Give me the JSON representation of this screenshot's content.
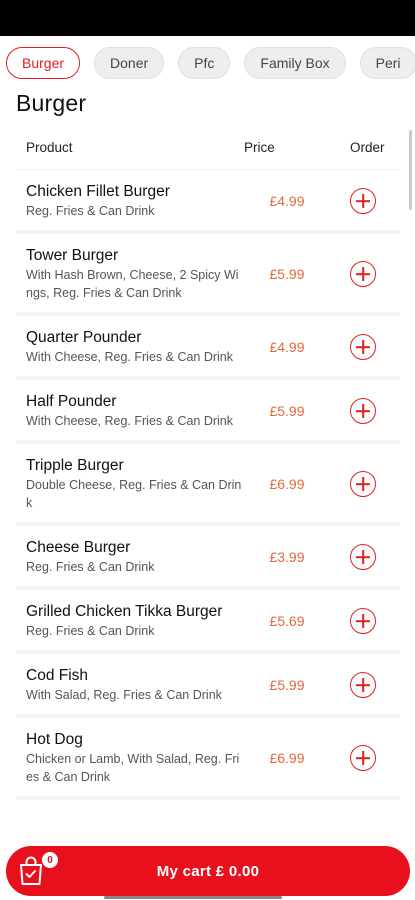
{
  "categories": [
    {
      "label": "Burger",
      "active": true
    },
    {
      "label": "Doner",
      "active": false
    },
    {
      "label": "Pfc",
      "active": false
    },
    {
      "label": "Family Box",
      "active": false
    },
    {
      "label": "Peri",
      "active": false
    }
  ],
  "section_title": "Burger",
  "table_header": {
    "product": "Product",
    "price": "Price",
    "order": "Order"
  },
  "items": [
    {
      "name": "Chicken Fillet Burger",
      "desc": "Reg. Fries  & Can Drink",
      "price": "£4.99"
    },
    {
      "name": "Tower Burger",
      "desc": "With Hash Brown, Cheese,  2 Spicy Wings, Reg. Fries  & Can Drink",
      "price": "£5.99"
    },
    {
      "name": "Quarter Pounder",
      "desc": "With Cheese, Reg. Fries  & Can Drink",
      "price": "£4.99"
    },
    {
      "name": "Half Pounder",
      "desc": "With Cheese, Reg. Fries  & Can Drink",
      "price": "£5.99"
    },
    {
      "name": "Tripple Burger",
      "desc": "Double Cheese, Reg. Fries  & Can Drink",
      "price": "£6.99"
    },
    {
      "name": "Cheese Burger",
      "desc": "Reg. Fries  & Can Drink",
      "price": "£3.99"
    },
    {
      "name": "Grilled Chicken Tikka Burger",
      "desc": "Reg. Fries & Can Drink",
      "price": "£5.69"
    },
    {
      "name": "Cod Fish",
      "desc": "With Salad, Reg. Fries & Can Drink",
      "price": "£5.99"
    },
    {
      "name": "Hot Dog",
      "desc": "Chicken or Lamb, With Salad, Reg. Fries & Can Drink",
      "price": "£6.99"
    }
  ],
  "cart": {
    "label": "My cart  £ 0.00",
    "badge": "0"
  },
  "colors": {
    "accent": "#e8101c",
    "price": "#e06a40"
  },
  "icons": {
    "add": "plus-circle-icon",
    "cart": "shopping-bag-icon"
  }
}
